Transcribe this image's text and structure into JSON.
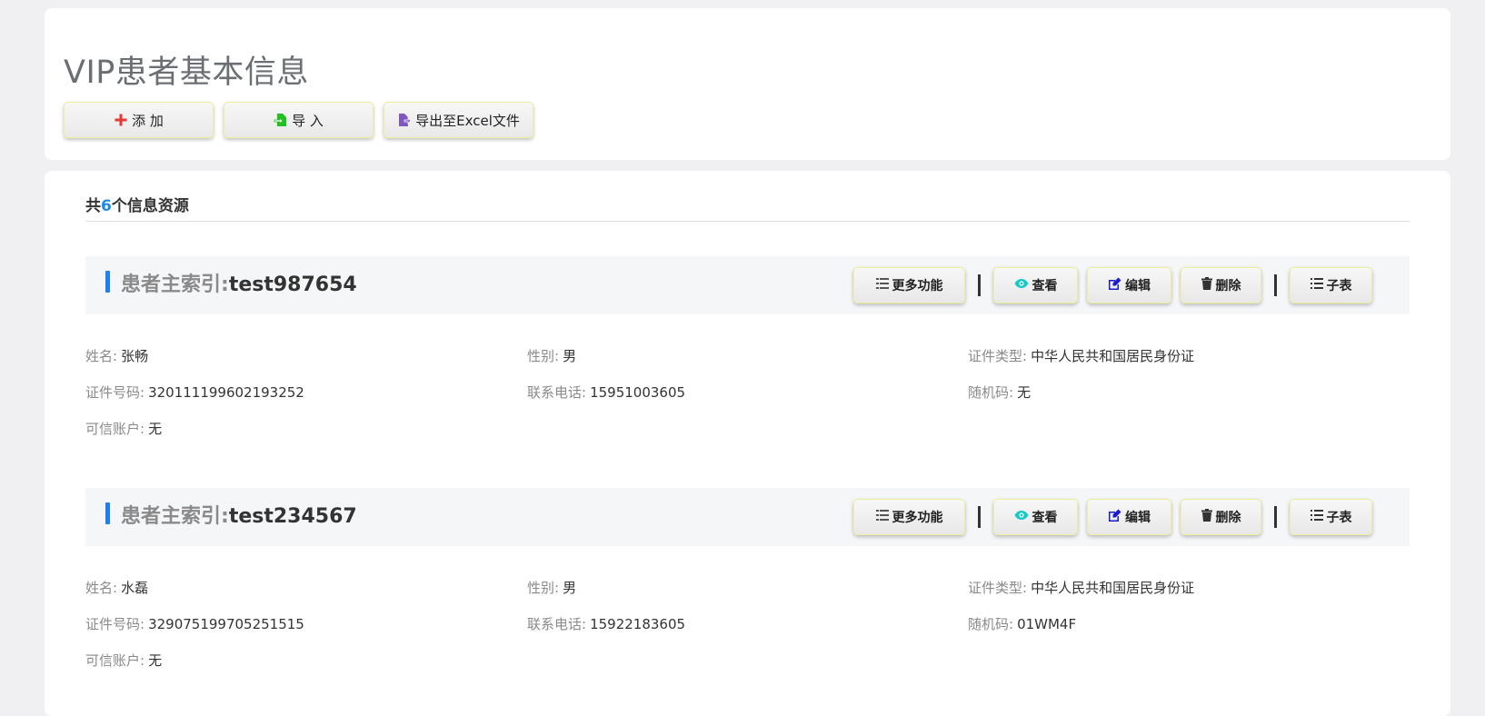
{
  "header": {
    "title": "VIP患者基本信息",
    "toolbar": {
      "add_label": "添 加",
      "import_label": "导 入",
      "export_label": "导出至Excel文件"
    }
  },
  "summary": {
    "prefix": "共",
    "count": "6",
    "suffix": "个信息资源"
  },
  "labels": {
    "index": "患者主索引:",
    "more": "更多功能",
    "view": "查看",
    "edit": "编辑",
    "delete": "删除",
    "sub": "子表",
    "name": "姓名:",
    "gender": "性别:",
    "id_type": "证件类型:",
    "id_no": "证件号码:",
    "phone": "联系电话:",
    "random": "随机码:",
    "trusted": "可信账户:"
  },
  "records": [
    {
      "index": "test987654",
      "name": "张畅",
      "gender": "男",
      "id_type": "中华人民共和国居民身份证",
      "id_no": "320111199602193252",
      "phone": "15951003605",
      "random": "无",
      "trusted": "无"
    },
    {
      "index": "test234567",
      "name": "水磊",
      "gender": "男",
      "id_type": "中华人民共和国居民身份证",
      "id_no": "329075199705251515",
      "phone": "15922183605",
      "random": "01WM4F",
      "trusted": "无"
    }
  ],
  "colors": {
    "accent": "#1e88e5",
    "add": "#e53935",
    "import": "#22c122",
    "export": "#7e57c2",
    "view": "#18c7c7",
    "edit": "#1a1ad1"
  },
  "icons": {
    "add": "plus-icon",
    "import": "file-import-icon",
    "export": "file-export-icon",
    "more": "list-icon",
    "view": "eye-icon",
    "edit": "edit-icon",
    "delete": "trash-icon",
    "sub": "list-ol-icon"
  }
}
